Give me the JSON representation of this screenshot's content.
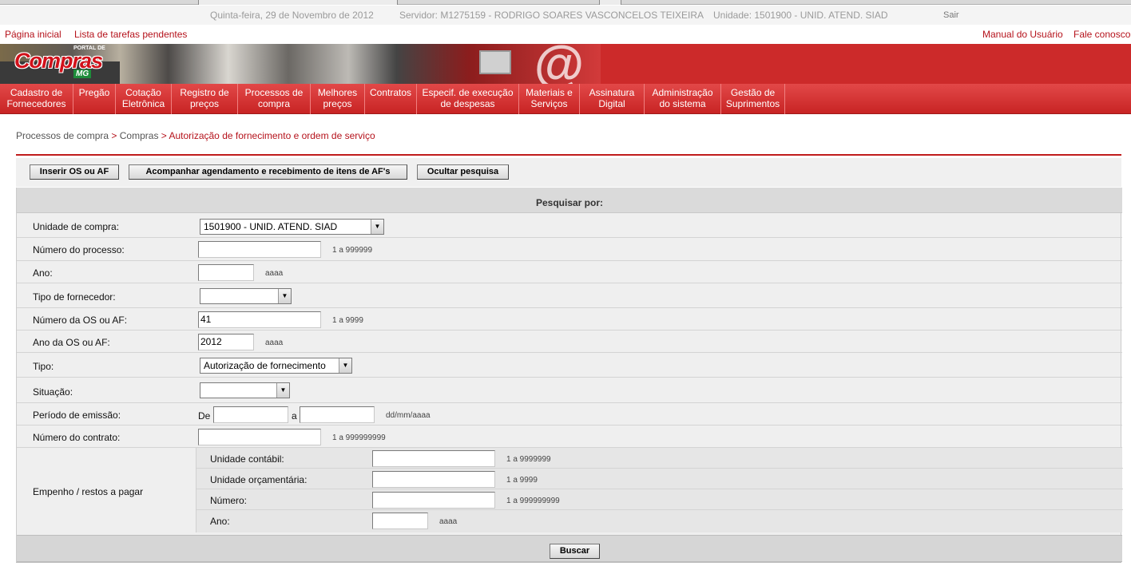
{
  "infobar": {
    "date": "Quinta-feira, 29 de Novembro de 2012",
    "server": "Servidor: M1275159 - RODRIGO SOARES VASCONCELOS TEIXEIRA",
    "unit": "Unidade: 1501900 - UNID. ATEND. SIAD",
    "logout": "Sair"
  },
  "links": {
    "home": "Página inicial",
    "pending_tasks": "Lista de tarefas pendentes",
    "manual": "Manual do Usuário",
    "contact": "Fale conosco"
  },
  "logo": {
    "portal": "PORTAL DE",
    "name": "Compras",
    "state": "MG"
  },
  "menu": [
    {
      "line1": "Cadastro de",
      "line2": "Fornecedores"
    },
    {
      "line1": "Pregão",
      "line2": ""
    },
    {
      "line1": "Cotação",
      "line2": "Eletrônica"
    },
    {
      "line1": "Registro de",
      "line2": "preços"
    },
    {
      "line1": "Processos de",
      "line2": "compra"
    },
    {
      "line1": "Melhores",
      "line2": "preços"
    },
    {
      "line1": "Contratos",
      "line2": ""
    },
    {
      "line1": "Especif. de execução",
      "line2": "de despesas"
    },
    {
      "line1": "Materiais e",
      "line2": "Serviços"
    },
    {
      "line1": "Assinatura",
      "line2": "Digital"
    },
    {
      "line1": "Administração",
      "line2": "do sistema"
    },
    {
      "line1": "Gestão de",
      "line2": "Suprimentos"
    }
  ],
  "breadcrumb": {
    "level1": "Processos de compra",
    "sep": ">",
    "level2": "Compras",
    "current": "Autorização de fornecimento e ordem de serviço"
  },
  "toolbar": {
    "insert_label": "Inserir OS ou AF",
    "track_label": "Acompanhar agendamento e recebimento de itens de AF's",
    "hide_label": "Ocultar pesquisa"
  },
  "search": {
    "title": "Pesquisar por:",
    "fields": {
      "unidade_compra": {
        "label": "Unidade de compra:",
        "value": "1501900 - UNID. ATEND. SIAD"
      },
      "numero_processo": {
        "label": "Número do processo:",
        "value": "",
        "hint": "1 a 999999"
      },
      "ano": {
        "label": "Ano:",
        "value": "",
        "hint": "aaaa"
      },
      "tipo_fornecedor": {
        "label": "Tipo de fornecedor:",
        "value": ""
      },
      "numero_os_af": {
        "label": "Número da OS ou AF:",
        "value": "41",
        "hint": "1 a 9999"
      },
      "ano_os_af": {
        "label": "Ano da OS ou AF:",
        "value": "2012",
        "hint": "aaaa"
      },
      "tipo": {
        "label": "Tipo:",
        "value": "Autorização de fornecimento"
      },
      "situacao": {
        "label": "Situação:",
        "value": ""
      },
      "periodo_emissao": {
        "label": "Período de emissão:",
        "from_label": "De",
        "to_label": "a",
        "from": "",
        "to": "",
        "hint": "dd/mm/aaaa"
      },
      "numero_contrato": {
        "label": "Número do contrato:",
        "value": "",
        "hint": "1 a 999999999"
      }
    },
    "empenho": {
      "label": "Empenho / restos a pagar",
      "unidade_contabil": {
        "label": "Unidade contábil:",
        "value": "",
        "hint": "1 a 9999999"
      },
      "unidade_orcamentaria": {
        "label": "Unidade orçamentária:",
        "value": "",
        "hint": "1 a 9999"
      },
      "numero": {
        "label": "Número:",
        "value": "",
        "hint": "1 a 999999999"
      },
      "ano": {
        "label": "Ano:",
        "value": "",
        "hint": "aaaa"
      }
    },
    "submit_label": "Buscar"
  },
  "colors": {
    "brand_red": "#cc2a2a",
    "link_red": "#b5121b",
    "form_bg": "#efefef"
  }
}
